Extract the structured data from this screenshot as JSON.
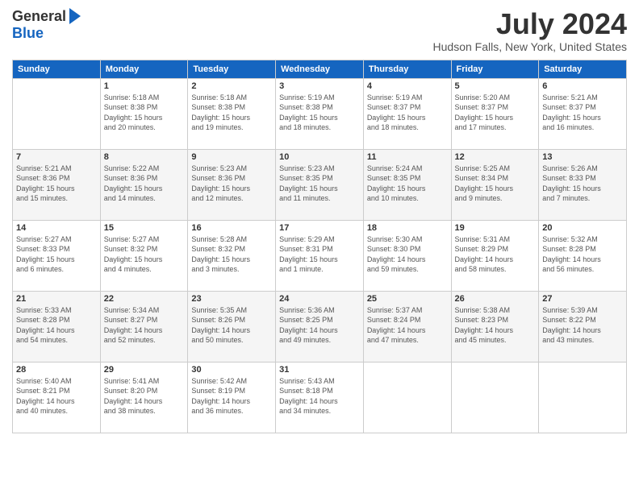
{
  "header": {
    "logo_general": "General",
    "logo_blue": "Blue",
    "title": "July 2024",
    "location": "Hudson Falls, New York, United States"
  },
  "days": [
    "Sunday",
    "Monday",
    "Tuesday",
    "Wednesday",
    "Thursday",
    "Friday",
    "Saturday"
  ],
  "weeks": [
    [
      {
        "date": "",
        "text": ""
      },
      {
        "date": "1",
        "text": "Sunrise: 5:18 AM\nSunset: 8:38 PM\nDaylight: 15 hours\nand 20 minutes."
      },
      {
        "date": "2",
        "text": "Sunrise: 5:18 AM\nSunset: 8:38 PM\nDaylight: 15 hours\nand 19 minutes."
      },
      {
        "date": "3",
        "text": "Sunrise: 5:19 AM\nSunset: 8:38 PM\nDaylight: 15 hours\nand 18 minutes."
      },
      {
        "date": "4",
        "text": "Sunrise: 5:19 AM\nSunset: 8:37 PM\nDaylight: 15 hours\nand 18 minutes."
      },
      {
        "date": "5",
        "text": "Sunrise: 5:20 AM\nSunset: 8:37 PM\nDaylight: 15 hours\nand 17 minutes."
      },
      {
        "date": "6",
        "text": "Sunrise: 5:21 AM\nSunset: 8:37 PM\nDaylight: 15 hours\nand 16 minutes."
      }
    ],
    [
      {
        "date": "7",
        "text": "Sunrise: 5:21 AM\nSunset: 8:36 PM\nDaylight: 15 hours\nand 15 minutes."
      },
      {
        "date": "8",
        "text": "Sunrise: 5:22 AM\nSunset: 8:36 PM\nDaylight: 15 hours\nand 14 minutes."
      },
      {
        "date": "9",
        "text": "Sunrise: 5:23 AM\nSunset: 8:36 PM\nDaylight: 15 hours\nand 12 minutes."
      },
      {
        "date": "10",
        "text": "Sunrise: 5:23 AM\nSunset: 8:35 PM\nDaylight: 15 hours\nand 11 minutes."
      },
      {
        "date": "11",
        "text": "Sunrise: 5:24 AM\nSunset: 8:35 PM\nDaylight: 15 hours\nand 10 minutes."
      },
      {
        "date": "12",
        "text": "Sunrise: 5:25 AM\nSunset: 8:34 PM\nDaylight: 15 hours\nand 9 minutes."
      },
      {
        "date": "13",
        "text": "Sunrise: 5:26 AM\nSunset: 8:33 PM\nDaylight: 15 hours\nand 7 minutes."
      }
    ],
    [
      {
        "date": "14",
        "text": "Sunrise: 5:27 AM\nSunset: 8:33 PM\nDaylight: 15 hours\nand 6 minutes."
      },
      {
        "date": "15",
        "text": "Sunrise: 5:27 AM\nSunset: 8:32 PM\nDaylight: 15 hours\nand 4 minutes."
      },
      {
        "date": "16",
        "text": "Sunrise: 5:28 AM\nSunset: 8:32 PM\nDaylight: 15 hours\nand 3 minutes."
      },
      {
        "date": "17",
        "text": "Sunrise: 5:29 AM\nSunset: 8:31 PM\nDaylight: 15 hours\nand 1 minute."
      },
      {
        "date": "18",
        "text": "Sunrise: 5:30 AM\nSunset: 8:30 PM\nDaylight: 14 hours\nand 59 minutes."
      },
      {
        "date": "19",
        "text": "Sunrise: 5:31 AM\nSunset: 8:29 PM\nDaylight: 14 hours\nand 58 minutes."
      },
      {
        "date": "20",
        "text": "Sunrise: 5:32 AM\nSunset: 8:28 PM\nDaylight: 14 hours\nand 56 minutes."
      }
    ],
    [
      {
        "date": "21",
        "text": "Sunrise: 5:33 AM\nSunset: 8:28 PM\nDaylight: 14 hours\nand 54 minutes."
      },
      {
        "date": "22",
        "text": "Sunrise: 5:34 AM\nSunset: 8:27 PM\nDaylight: 14 hours\nand 52 minutes."
      },
      {
        "date": "23",
        "text": "Sunrise: 5:35 AM\nSunset: 8:26 PM\nDaylight: 14 hours\nand 50 minutes."
      },
      {
        "date": "24",
        "text": "Sunrise: 5:36 AM\nSunset: 8:25 PM\nDaylight: 14 hours\nand 49 minutes."
      },
      {
        "date": "25",
        "text": "Sunrise: 5:37 AM\nSunset: 8:24 PM\nDaylight: 14 hours\nand 47 minutes."
      },
      {
        "date": "26",
        "text": "Sunrise: 5:38 AM\nSunset: 8:23 PM\nDaylight: 14 hours\nand 45 minutes."
      },
      {
        "date": "27",
        "text": "Sunrise: 5:39 AM\nSunset: 8:22 PM\nDaylight: 14 hours\nand 43 minutes."
      }
    ],
    [
      {
        "date": "28",
        "text": "Sunrise: 5:40 AM\nSunset: 8:21 PM\nDaylight: 14 hours\nand 40 minutes."
      },
      {
        "date": "29",
        "text": "Sunrise: 5:41 AM\nSunset: 8:20 PM\nDaylight: 14 hours\nand 38 minutes."
      },
      {
        "date": "30",
        "text": "Sunrise: 5:42 AM\nSunset: 8:19 PM\nDaylight: 14 hours\nand 36 minutes."
      },
      {
        "date": "31",
        "text": "Sunrise: 5:43 AM\nSunset: 8:18 PM\nDaylight: 14 hours\nand 34 minutes."
      },
      {
        "date": "",
        "text": ""
      },
      {
        "date": "",
        "text": ""
      },
      {
        "date": "",
        "text": ""
      }
    ]
  ]
}
